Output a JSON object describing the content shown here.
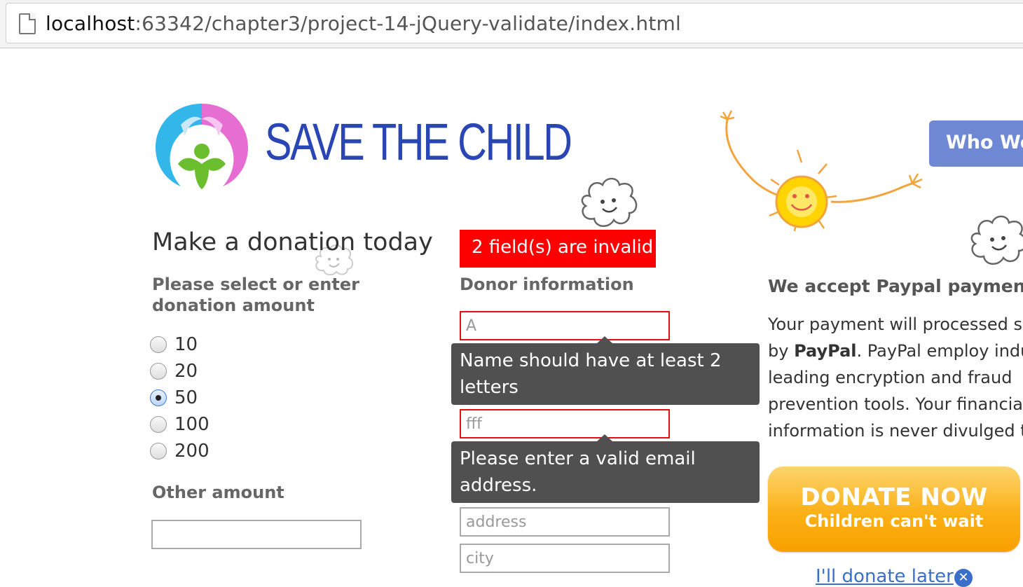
{
  "browser": {
    "url_host": "localhost",
    "url_rest": ":63342/chapter3/project-14-jQuery-validate/index.html"
  },
  "header": {
    "logo_text": "SAVE THE CHILD",
    "nav_button": "Who We A"
  },
  "donation": {
    "heading": "Make a donation today",
    "select_label": "Please select or enter donation amount",
    "options": [
      {
        "label": "10",
        "checked": false
      },
      {
        "label": "20",
        "checked": false
      },
      {
        "label": "50",
        "checked": true
      },
      {
        "label": "100",
        "checked": false
      },
      {
        "label": "200",
        "checked": false
      }
    ],
    "other_label": "Other amount",
    "other_value": ""
  },
  "donor": {
    "invalid_banner": "2 field(s) are invalid",
    "heading": "Donor information",
    "name_value": "A",
    "name_error": "Name should have at least 2 letters",
    "email_value": "fff",
    "email_error": "Please enter a valid email address.",
    "address_placeholder": "address",
    "city_placeholder": "city"
  },
  "paypal": {
    "heading": "We accept Paypal payments",
    "text_lines": [
      "Your payment will processed se",
      "by PayPal. PayPal employ indus",
      "leading encryption and fraud",
      "prevention tools. Your financial",
      "information is never divulged to"
    ],
    "donate_main": "DONATE NOW",
    "donate_sub": "Children can't wait",
    "later_link": "I'll donate later"
  },
  "colors": {
    "brand_blue": "#2a46b4",
    "error_red": "#ff0000",
    "tooltip_gray": "#505050",
    "donate_orange": "#fbb016",
    "nav_blue": "#6e88d3"
  }
}
